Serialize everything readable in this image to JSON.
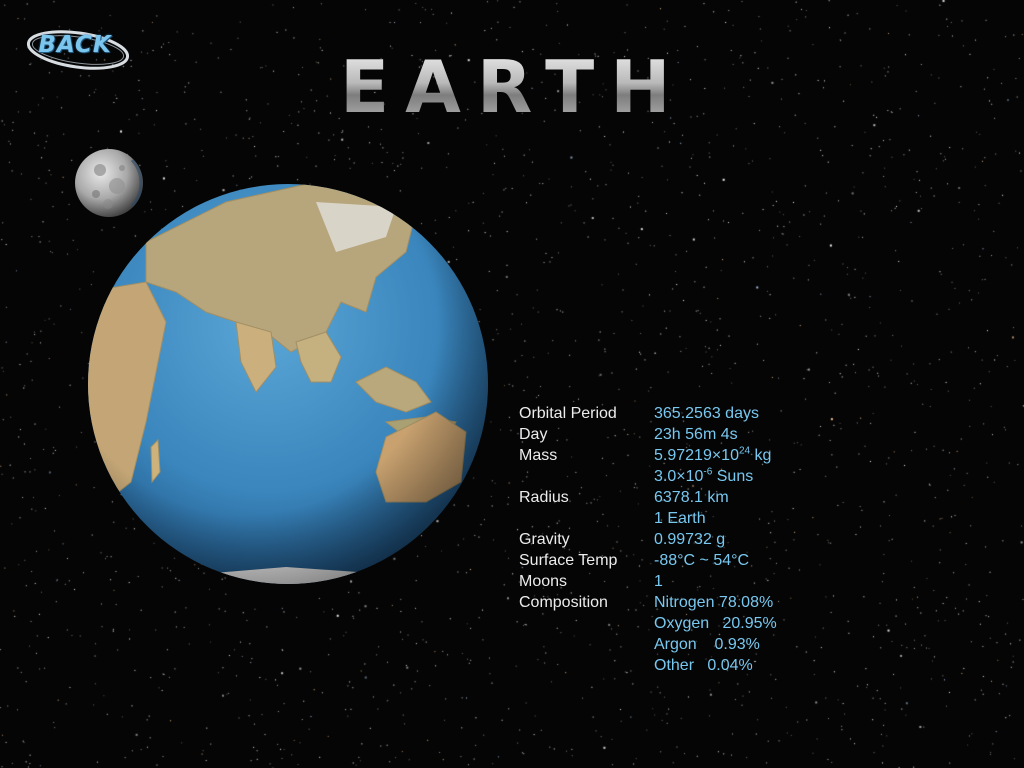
{
  "back_button": {
    "label": "BACK"
  },
  "title": "EARTH",
  "info": [
    {
      "label": "Orbital Period",
      "value": "365.2563 days"
    },
    {
      "label": "Day",
      "value": "23h 56m 4s"
    },
    {
      "label": "Mass",
      "value_base": "5.97219×10",
      "value_exp": "24",
      "value_unit": " kg"
    },
    {
      "label": "",
      "value_base": "3.0×10",
      "value_exp": "-6",
      "value_unit": " Suns"
    },
    {
      "label": "Radius",
      "value": "6378.1 km"
    },
    {
      "label": "",
      "value": "1 Earth"
    },
    {
      "label": "Gravity",
      "value": "0.99732 g"
    },
    {
      "label": "Surface Temp",
      "value": "-88°C ~ 54°C"
    },
    {
      "label": "Moons",
      "value": "1"
    },
    {
      "label": "Composition",
      "value": "Nitrogen 78.08%"
    },
    {
      "label": "",
      "value": "Oxygen   20.95%"
    },
    {
      "label": "",
      "value": "Argon    0.93%"
    },
    {
      "label": "",
      "value": "Other   0.04%"
    }
  ],
  "colors": {
    "label": "#ececec",
    "value": "#78c8f0",
    "background": "#050505",
    "back_accent": "#7cc6ee"
  },
  "icons": {
    "back": "back-ring-icon",
    "moon": "moon-icon",
    "earth": "earth-globe-icon"
  }
}
